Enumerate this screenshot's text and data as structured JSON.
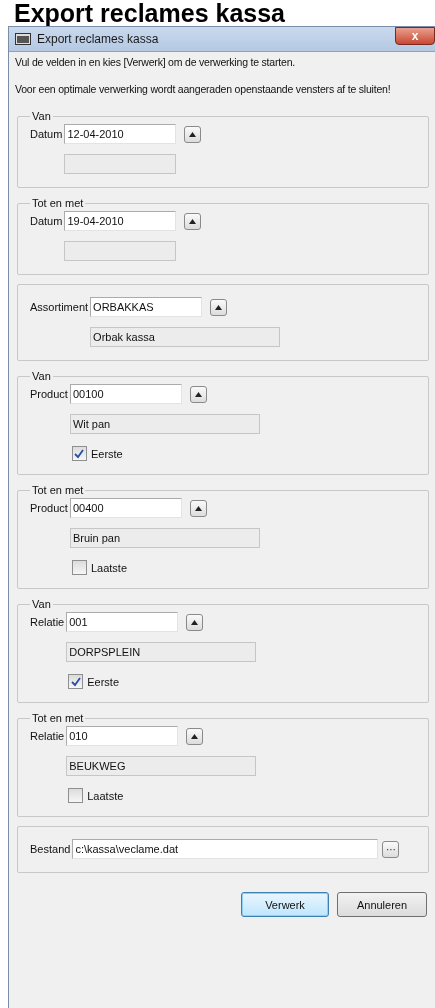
{
  "heading": "Export reclames kassa",
  "window": {
    "title": "Export reclames kassa",
    "close": "x"
  },
  "intro": [
    "Vul de velden in en kies [Verwerk] om de verwerking te starten.",
    "Voor een optimale verwerking wordt aangeraden openstaande vensters af te sluiten!"
  ],
  "groups": [
    {
      "kind": "lookup",
      "legend": "Van",
      "label": "Datum",
      "value": "12-04-2010",
      "empty_description": true
    },
    {
      "kind": "lookup",
      "legend": "Tot en met",
      "label": "Datum",
      "value": "19-04-2010",
      "empty_description": true
    },
    {
      "kind": "lookup",
      "label": "Assortiment",
      "value": "ORBAKKAS",
      "description": "Orbak kassa"
    },
    {
      "kind": "lookup",
      "legend": "Van",
      "label": "Product",
      "value": "00100",
      "description": "Wit pan",
      "checkbox": {
        "label": "Eerste",
        "checked": true
      }
    },
    {
      "kind": "lookup",
      "legend": "Tot en met",
      "label": "Product",
      "value": "00400",
      "description": "Bruin pan",
      "checkbox": {
        "label": "Laatste",
        "checked": false
      }
    },
    {
      "kind": "lookup",
      "legend": "Van",
      "label": "Relatie",
      "value": "001",
      "description": "DORPSPLEIN",
      "checkbox": {
        "label": "Eerste",
        "checked": true
      }
    },
    {
      "kind": "lookup",
      "legend": "Tot en met",
      "label": "Relatie",
      "value": "010",
      "description": "BEUKWEG",
      "checkbox": {
        "label": "Laatste",
        "checked": false
      }
    },
    {
      "kind": "file",
      "label": "Bestand",
      "value": "c:\\kassa\\veclame.dat",
      "browse": "···"
    }
  ],
  "buttons": [
    {
      "label": "Verwerk",
      "default": true
    },
    {
      "label": "Annuleren",
      "default": false
    }
  ]
}
